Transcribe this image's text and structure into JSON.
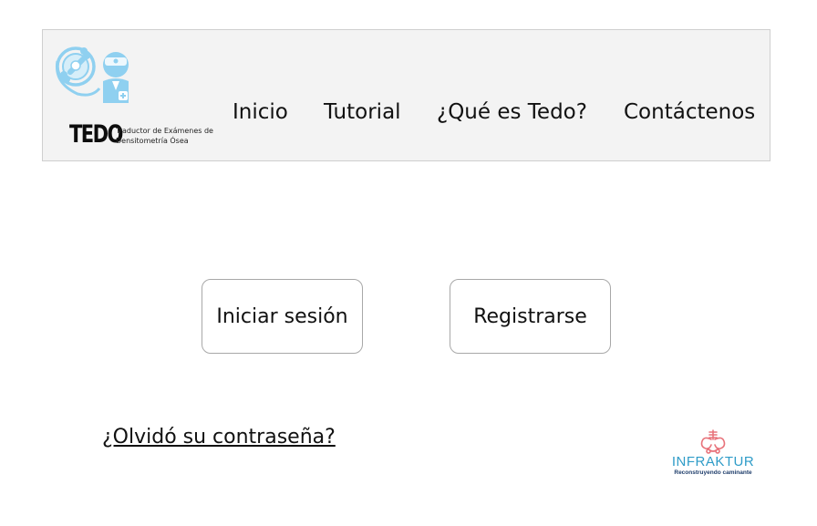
{
  "header": {
    "logo": {
      "wordmark": "TEDO",
      "tagline_line1": "Traductor de Exámenes de",
      "tagline_line2": "Densitometría Ósea",
      "icon": "bone-densitometry-logo-icon"
    },
    "nav": [
      {
        "label": "Inicio"
      },
      {
        "label": "Tutorial"
      },
      {
        "label": "¿Qué es Tedo?"
      },
      {
        "label": "Contáctenos"
      }
    ]
  },
  "main": {
    "login_label": "Iniciar sesión",
    "register_label": "Registrarse",
    "forgot_password_label": "¿Olvidó su contraseña?"
  },
  "footer_brand": {
    "name": "INFRAKTUR",
    "tagline": "Reconstruyendo caminante",
    "icon": "pelvis-icon"
  },
  "colors": {
    "header_bg": "#f3f3f3",
    "logo_light_blue": "#8fd0f0",
    "brand_blue": "#2f9cc8",
    "brand_coral": "#e8737b",
    "brand_navy": "#1e3d6b"
  }
}
